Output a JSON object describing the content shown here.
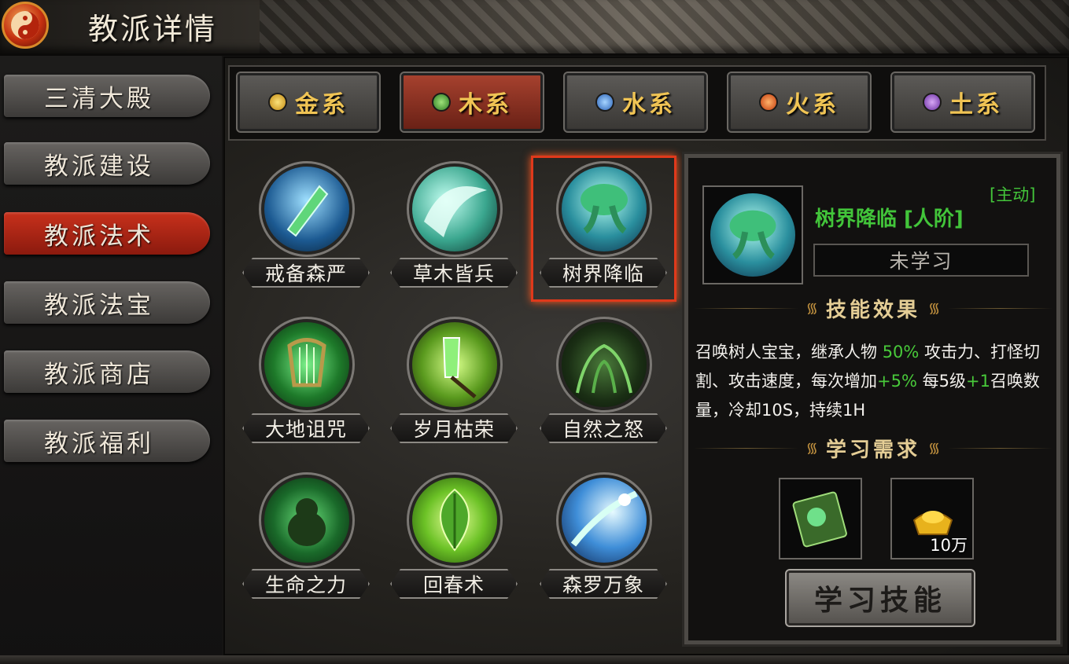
{
  "header": {
    "title": "教派详情"
  },
  "sidebar": {
    "items": [
      {
        "label": "三清大殿",
        "active": false
      },
      {
        "label": "教派建设",
        "active": false
      },
      {
        "label": "教派法术",
        "active": true
      },
      {
        "label": "教派法宝",
        "active": false
      },
      {
        "label": "教派商店",
        "active": false
      },
      {
        "label": "教派福利",
        "active": false
      }
    ]
  },
  "element_tabs": [
    {
      "label": "金系",
      "icon": "gold-element-icon",
      "color": "#e3b12d",
      "active": false
    },
    {
      "label": "木系",
      "icon": "wood-element-icon",
      "color": "#3ea33a",
      "active": true
    },
    {
      "label": "水系",
      "icon": "water-element-icon",
      "color": "#3d7fd6",
      "active": false
    },
    {
      "label": "火系",
      "icon": "fire-element-icon",
      "color": "#e0531d",
      "active": false
    },
    {
      "label": "土系",
      "icon": "earth-element-icon",
      "color": "#9a5ac8",
      "active": false
    }
  ],
  "skills": [
    {
      "name": "戒备森严",
      "icon": "sword-shield-icon"
    },
    {
      "name": "草木皆兵",
      "icon": "wave-blade-icon"
    },
    {
      "name": "树界降临",
      "icon": "tree-spirit-icon",
      "selected": true
    },
    {
      "name": "大地诅咒",
      "icon": "harp-icon"
    },
    {
      "name": "岁月枯荣",
      "icon": "crystal-branch-icon"
    },
    {
      "name": "自然之怒",
      "icon": "vines-icon"
    },
    {
      "name": "生命之力",
      "icon": "beast-icon"
    },
    {
      "name": "回春术",
      "icon": "leaf-icon"
    },
    {
      "name": "森罗万象",
      "icon": "comet-icon"
    }
  ],
  "detail": {
    "type": "[主动]",
    "name": "树界降临 [人阶]",
    "status": "未学习",
    "effect_title": "技能效果",
    "effect": {
      "p1": "召唤树人宝宝，继承人物 ",
      "v1": "50%",
      "p2": " 攻击力、打怪切割、攻击速度，每次增加",
      "v2": "+5%",
      "p3": " 每5级",
      "v3": "+1",
      "p4": "召唤数量，冷却10S，持续1H"
    },
    "requirement_title": "学习需求",
    "requirements": [
      {
        "icon": "skill-book-icon",
        "amount": ""
      },
      {
        "icon": "gold-ingot-icon",
        "amount": "10万"
      }
    ],
    "learn_button": "学习技能"
  },
  "colors": {
    "accent_red": "#e0391b",
    "skill_green": "#42c53a",
    "tab_text_gold": "#f0c454"
  }
}
